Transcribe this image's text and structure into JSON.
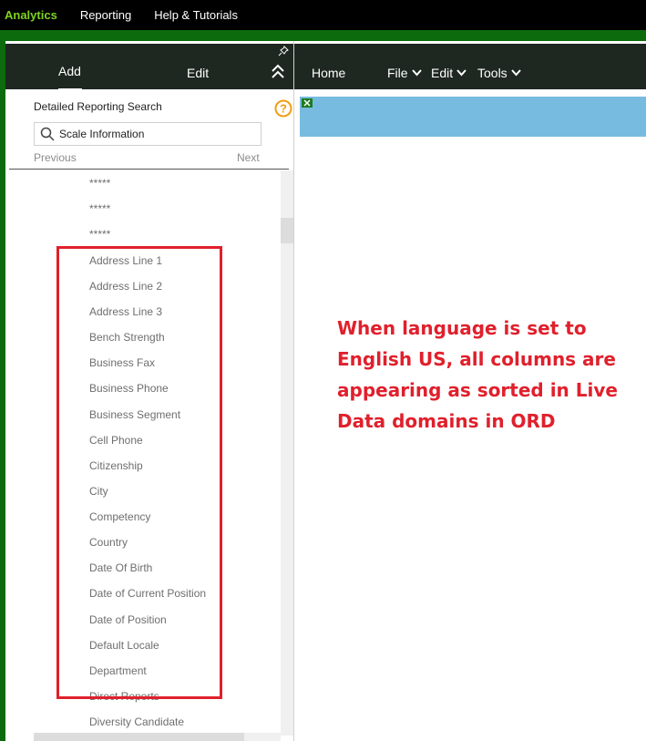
{
  "topnav": {
    "items": [
      "Analytics",
      "Reporting",
      "Help & Tutorials"
    ]
  },
  "left_panel": {
    "tabs": {
      "add": "Add",
      "edit": "Edit"
    },
    "search_label": "Detailed Reporting Search",
    "search_value": "Scale Information",
    "previous": "Previous",
    "next": "Next",
    "items": [
      "*****",
      "*****",
      "*****",
      "Address Line 1",
      "Address Line 2",
      "Address Line 3",
      "Bench Strength",
      "Business Fax",
      "Business Phone",
      "Business Segment",
      "Cell Phone",
      "Citizenship",
      "City",
      "Competency",
      "Country",
      "Date Of Birth",
      "Date of Current Position",
      "Date of Position",
      "Default Locale",
      "Department",
      "Direct Reports",
      "Diversity Candidate"
    ]
  },
  "right_panel": {
    "menu": {
      "home": "Home",
      "file": "File",
      "edit": "Edit",
      "tools": "Tools"
    }
  },
  "annotation": {
    "text": "When language is set to English US, all columns are appearing as sorted in Live Data domains in ORD"
  },
  "colors": {
    "nav_active": "#7ed321",
    "header_bg": "#1e2720",
    "banner": "#78bbe0",
    "highlight": "#e0202c",
    "border_green": "#0c6b0c",
    "help_icon": "#f39c12"
  },
  "icons": [
    "pin-icon",
    "collapse-up-icon",
    "help-icon",
    "search-icon",
    "chevron-down-icon",
    "excel-icon"
  ]
}
